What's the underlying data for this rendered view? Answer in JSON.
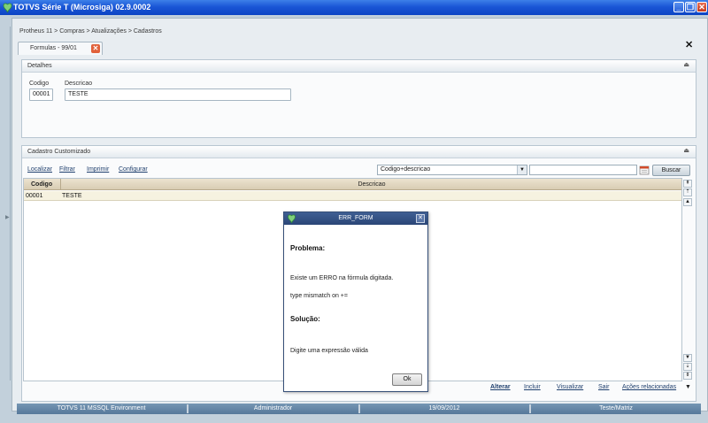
{
  "window": {
    "title": "TOTVS Série T  (Microsiga) 02.9.0002",
    "minimize": "_",
    "restore": "❐",
    "close": "✕"
  },
  "breadcrumb": "Protheus 11 > Compras  > Atualizações > Cadastros",
  "tab": {
    "label": "Formulas - 99/01",
    "close": "✕"
  },
  "outer_close": "✕",
  "detalhes": {
    "title": "Detalhes",
    "collapse": "⏏",
    "codigo_label": "Codigo",
    "codigo_value": "00001",
    "descricao_label": "Descricao",
    "descricao_value": "TESTE"
  },
  "cadastro": {
    "title": "Cadastro Customizado",
    "collapse": "⏏",
    "toolbar": {
      "localizar": "Localizar",
      "filtrar": "Filtrar",
      "imprimir": "Imprimir",
      "configurar": "Configurar"
    },
    "ordem_selected": "Codigo+descricao",
    "ordem_arrow": "▼",
    "busca_value": "",
    "buscar_label": "Buscar",
    "grid": {
      "columns": [
        "Codigo",
        "Descricao"
      ],
      "rows": [
        [
          "00001",
          "TESTE"
        ]
      ]
    },
    "nav": {
      "first": "⇞",
      "prev_page": "⇡",
      "prev": "▲",
      "next": "▼",
      "next_page": "⇣",
      "last": "⇟"
    },
    "actions": {
      "alterar": "Alterar",
      "incluir": "Incluir",
      "visualizar": "Visualizar",
      "sair": "Sair",
      "acoes": "Ações relacionadas",
      "more": "▼"
    }
  },
  "status": {
    "environment": "TOTVS  11  MSSQL Environment",
    "user": "Administrador",
    "date": "19/09/2012",
    "company": "Teste/Matriz"
  },
  "dialog": {
    "title": "ERR_FORM",
    "close": "✕",
    "problema_heading": "Problema:",
    "problema_line1": "Existe um ERRO na fórmula digitada.",
    "problema_line2": " type mismatch on +=",
    "solucao_heading": "Solução:",
    "solucao_line1": "Digite uma expressão válida",
    "ok_label": "Ok"
  },
  "colors": {
    "titlebar": "#1a56d6",
    "dialog_header": "#2b4677",
    "grid_header": "#ddd2b9",
    "status_bar": "#56789a"
  }
}
